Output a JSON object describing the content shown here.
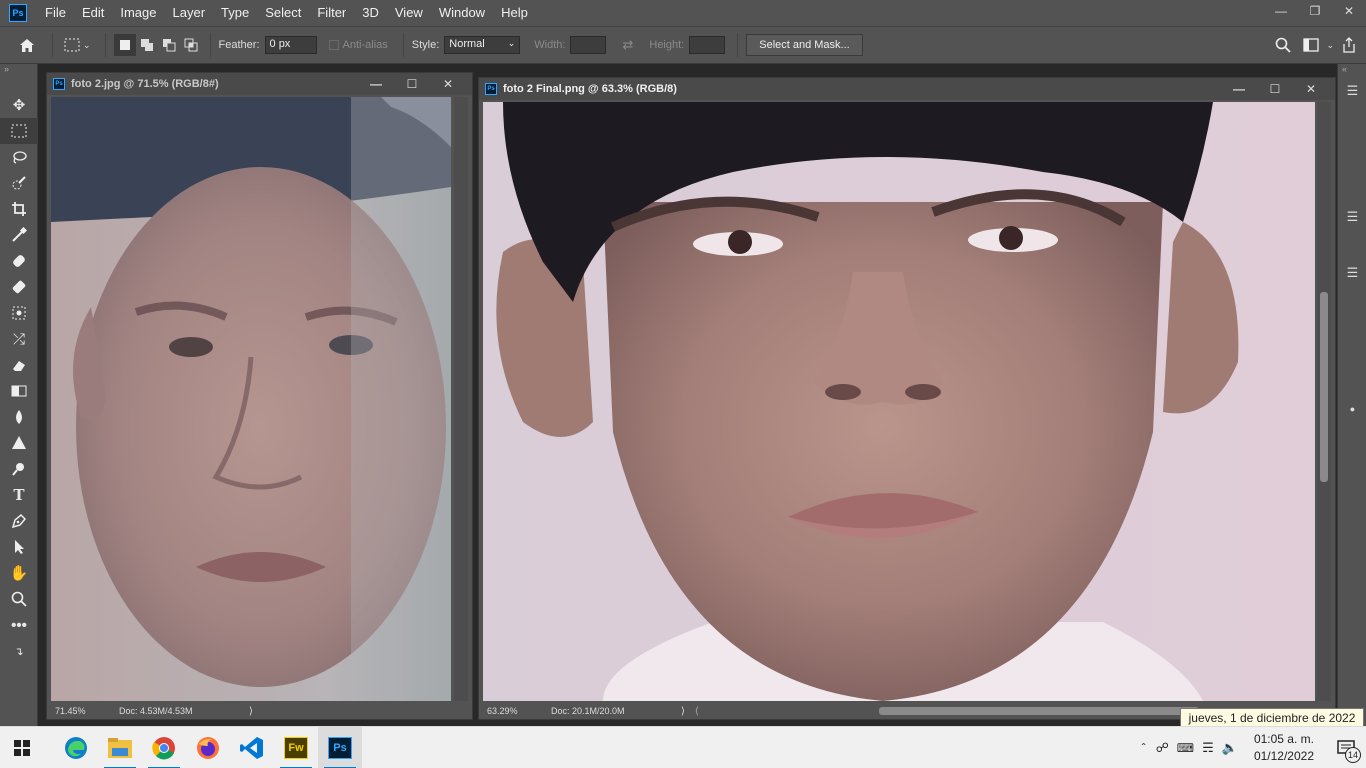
{
  "app": {
    "logo_text": "Ps"
  },
  "menu": [
    "File",
    "Edit",
    "Image",
    "Layer",
    "Type",
    "Select",
    "Filter",
    "3D",
    "View",
    "Window",
    "Help"
  ],
  "options": {
    "feather_label": "Feather:",
    "feather_value": "0 px",
    "antialias_label": "Anti-alias",
    "style_label": "Style:",
    "style_value": "Normal",
    "width_label": "Width:",
    "height_label": "Height:",
    "select_mask_label": "Select and Mask..."
  },
  "doc1": {
    "title": "foto 2.jpg @ 71.5% (RGB/8#)",
    "zoom": "71.45%",
    "doc_size": "Doc: 4.53M/4.53M"
  },
  "doc2": {
    "title": "foto 2 Final.png @ 63.3% (RGB/8)",
    "zoom": "63.29%",
    "doc_size": "Doc: 20.1M/20.0M"
  },
  "taskbar": {
    "time": "01:05 a. m.",
    "date": "01/12/2022",
    "tooltip": "jueves, 1 de diciembre de 2022",
    "notification_count": "14",
    "apps": [
      "edge",
      "file-explorer",
      "chrome",
      "firefox",
      "vscode",
      "fireworks",
      "photoshop"
    ],
    "fw_label": "Fw",
    "ps_label": "Ps"
  },
  "colors": {
    "accent": "#31a8ff",
    "ps_bg": "#001e36",
    "fw_bg": "#4a3d00",
    "fw_fg": "#f5d000",
    "ui_bg": "#535353"
  }
}
